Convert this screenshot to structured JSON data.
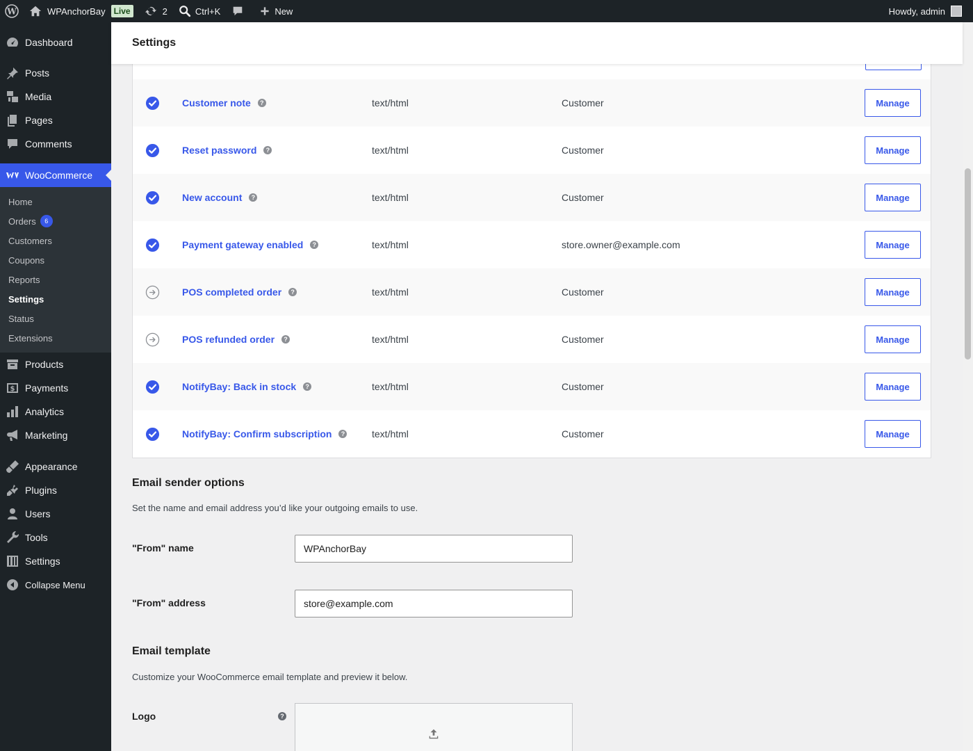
{
  "adminbar": {
    "site_name": "WPAnchorBay",
    "live_badge": "Live",
    "updates_count": "2",
    "search_shortcut": "Ctrl+K",
    "new_label": "New",
    "howdy": "Howdy, admin"
  },
  "sidebar": {
    "top": [
      {
        "label": "Dashboard",
        "icon": "dashboard-icon"
      },
      {
        "label": "Posts",
        "icon": "pin-icon"
      },
      {
        "label": "Media",
        "icon": "media-icon"
      },
      {
        "label": "Pages",
        "icon": "pages-icon"
      },
      {
        "label": "Comments",
        "icon": "comment-icon"
      },
      {
        "label": "WooCommerce",
        "icon": "woo-icon"
      }
    ],
    "woo_submenu": [
      {
        "label": "Home"
      },
      {
        "label": "Orders",
        "badge": "6"
      },
      {
        "label": "Customers"
      },
      {
        "label": "Coupons"
      },
      {
        "label": "Reports"
      },
      {
        "label": "Settings"
      },
      {
        "label": "Status"
      },
      {
        "label": "Extensions"
      }
    ],
    "bottom": [
      {
        "label": "Products",
        "icon": "archive-icon"
      },
      {
        "label": "Payments",
        "icon": "payments-icon"
      },
      {
        "label": "Analytics",
        "icon": "chart-bar-icon"
      },
      {
        "label": "Marketing",
        "icon": "megaphone-icon"
      },
      {
        "label": "Appearance",
        "icon": "brush-icon"
      },
      {
        "label": "Plugins",
        "icon": "plug-icon"
      },
      {
        "label": "Users",
        "icon": "user-icon"
      },
      {
        "label": "Tools",
        "icon": "wrench-icon"
      },
      {
        "label": "Settings",
        "icon": "sliders-icon"
      },
      {
        "label": "Collapse Menu",
        "icon": "collapse-icon"
      }
    ]
  },
  "header": {
    "title": "Settings"
  },
  "emails": {
    "manage_label": "Manage",
    "rows": [
      {
        "name": "Customer note",
        "type": "text/html",
        "recipient": "Customer",
        "status": "enabled"
      },
      {
        "name": "Reset password",
        "type": "text/html",
        "recipient": "Customer",
        "status": "enabled"
      },
      {
        "name": "New account",
        "type": "text/html",
        "recipient": "Customer",
        "status": "enabled"
      },
      {
        "name": "Payment gateway enabled",
        "type": "text/html",
        "recipient": "store.owner@example.com",
        "status": "enabled"
      },
      {
        "name": "POS completed order",
        "type": "text/html",
        "recipient": "Customer",
        "status": "manual"
      },
      {
        "name": "POS refunded order",
        "type": "text/html",
        "recipient": "Customer",
        "status": "manual"
      },
      {
        "name": "NotifyBay: Back in stock",
        "type": "text/html",
        "recipient": "Customer",
        "status": "enabled"
      },
      {
        "name": "NotifyBay: Confirm subscription",
        "type": "text/html",
        "recipient": "Customer",
        "status": "enabled"
      }
    ]
  },
  "sender": {
    "title": "Email sender options",
    "desc": "Set the name and email address you’d like your outgoing emails to use.",
    "from_name_label": "\"From\" name",
    "from_name_value": "WPAnchorBay",
    "from_address_label": "\"From\" address",
    "from_address_value": "store@example.com"
  },
  "template": {
    "title": "Email template",
    "desc": "Customize your WooCommerce email template and preview it below.",
    "logo_label": "Logo"
  },
  "colors": {
    "accent": "#3858e9",
    "sidebar_bg": "#1d2327",
    "submenu_bg": "#2c3338"
  }
}
